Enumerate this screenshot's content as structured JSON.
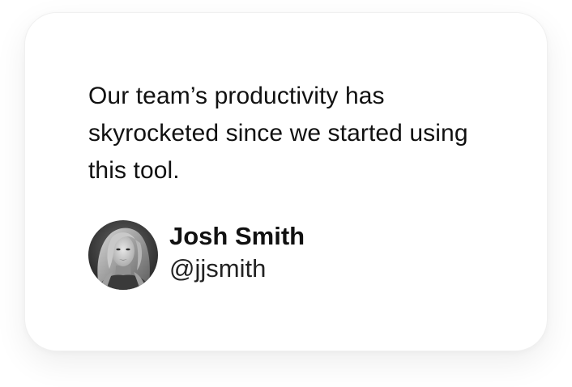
{
  "testimonial": {
    "quote": "Our team’s productivity has skyrocketed since we started using this tool.",
    "author": {
      "name": "Josh Smith",
      "handle": "@jjsmith",
      "avatar_icon": "user-photo-avatar"
    }
  }
}
